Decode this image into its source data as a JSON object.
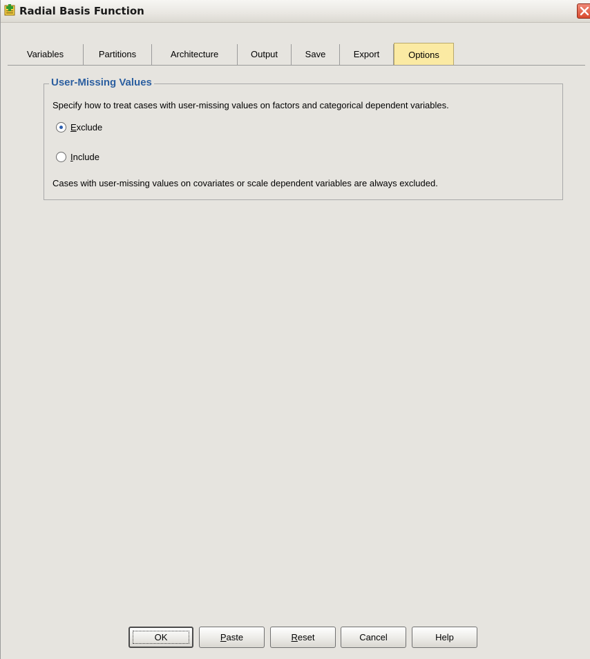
{
  "window": {
    "title": "Radial Basis Function"
  },
  "tabs": [
    {
      "label": "Variables",
      "active": false
    },
    {
      "label": "Partitions",
      "active": false
    },
    {
      "label": "Architecture",
      "active": false
    },
    {
      "label": "Output",
      "active": false
    },
    {
      "label": "Save",
      "active": false
    },
    {
      "label": "Export",
      "active": false
    },
    {
      "label": "Options",
      "active": true
    }
  ],
  "user_missing": {
    "group_title": "User-Missing Values",
    "description": "Specify how to treat cases with user-missing values on factors and categorical dependent variables.",
    "options": [
      {
        "label_mnemonic": "E",
        "label_rest": "xclude",
        "selected": true
      },
      {
        "label_mnemonic": "I",
        "label_rest": "nclude",
        "selected": false
      }
    ],
    "note": "Cases with user-missing values on covariates or scale dependent variables are always excluded."
  },
  "buttons": {
    "ok": "OK",
    "paste_mnemonic": "P",
    "paste_rest": "aste",
    "reset_mnemonic": "R",
    "reset_rest": "eset",
    "cancel": "Cancel",
    "help": "Help"
  },
  "colors": {
    "active_tab": "#fbeaa3",
    "group_title": "#2c5fa0",
    "close_button": "#d84a2e",
    "radio_dot": "#2d5fb0"
  },
  "icons": {
    "app": "spss-dialog-icon",
    "close": "close-icon"
  }
}
